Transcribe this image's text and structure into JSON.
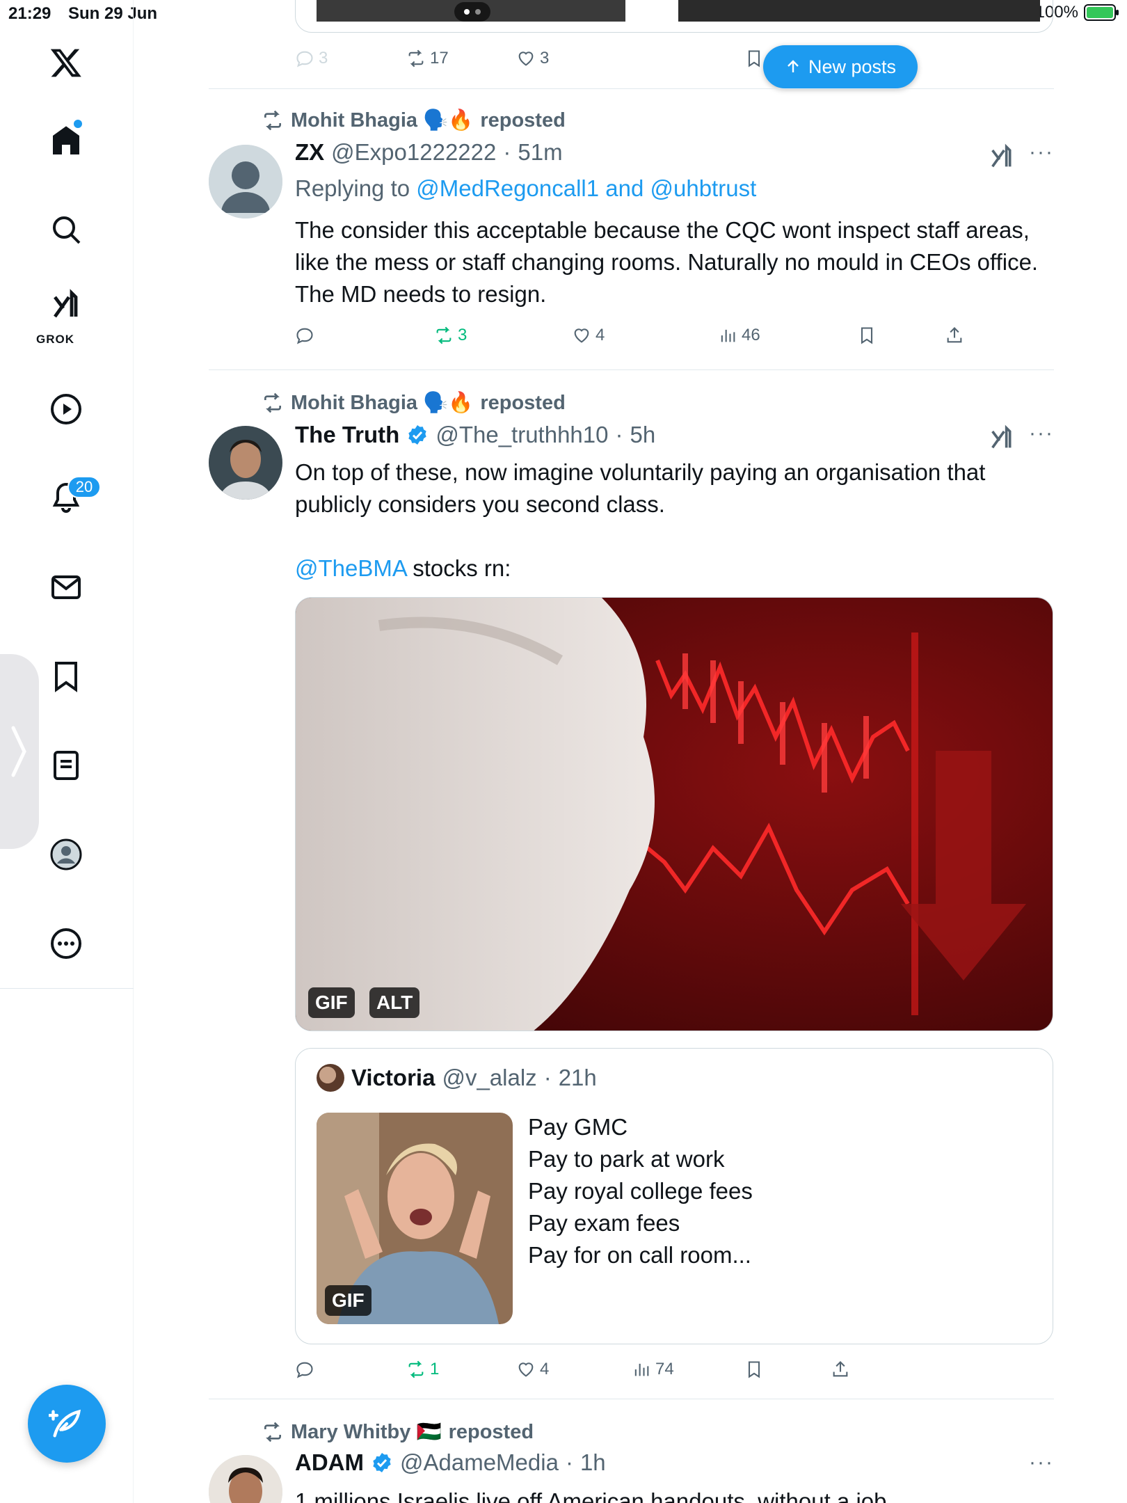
{
  "status_bar": {
    "time": "21:29",
    "date": "Sun 29 Jun",
    "battery": "100%"
  },
  "sidebar": {
    "items": [
      "home",
      "explore",
      "grok",
      "video",
      "notifications",
      "messages",
      "bookmarks",
      "lists",
      "profile",
      "more"
    ],
    "grok_label": "GROK",
    "notification_count": "20"
  },
  "feed": {
    "new_posts_label": "New posts",
    "top_actions": {
      "replies": "3",
      "reposts": "17",
      "likes": "3"
    },
    "posts": [
      {
        "repost_by": "Mohit Bhagia 🗣️🔥",
        "repost_suffix": "reposted",
        "name": "ZX",
        "handle": "@Expo1222222",
        "time": "51m",
        "replying_prefix": "Replying to",
        "replying_to_1": "@MedRegoncall1",
        "replying_and": "and",
        "replying_to_2": "@uhbtrust",
        "text": "The consider this acceptable because the CQC wont inspect staff areas, like the mess or staff changing rooms. Naturally no  mould in CEOs office. The MD needs to resign.",
        "reposts": "3",
        "likes": "4",
        "views": "46"
      },
      {
        "repost_by": "Mohit Bhagia 🗣️🔥",
        "repost_suffix": "reposted",
        "name": "The Truth",
        "handle": "@The_truthhh10",
        "time": "5h",
        "text_1": "On top of these, now imagine voluntarily paying an organisation that publicly considers you second class.",
        "mention": "@TheBMA",
        "text_2": " stocks rn:",
        "gif_tag": "GIF",
        "alt_tag": "ALT",
        "quote": {
          "name": "Victoria",
          "handle": "@v_alalz",
          "time": "21h",
          "gif_tag": "GIF",
          "lines": [
            "Pay GMC",
            "Pay to park at work",
            "Pay royal college fees",
            "Pay exam fees",
            "Pay for on call room..."
          ]
        },
        "reposts": "1",
        "likes": "4",
        "views": "74"
      },
      {
        "repost_by": "Mary Whitby 🇵🇸",
        "repost_suffix": "reposted",
        "name": "ADAM",
        "handle": "@AdameMedia",
        "time": "1h",
        "text": "1 millions Israelis live off American handouts, without a job"
      }
    ]
  },
  "colors": {
    "accent": "#1d9bf0",
    "repost_green": "#00ba7c",
    "muted": "#536471"
  }
}
